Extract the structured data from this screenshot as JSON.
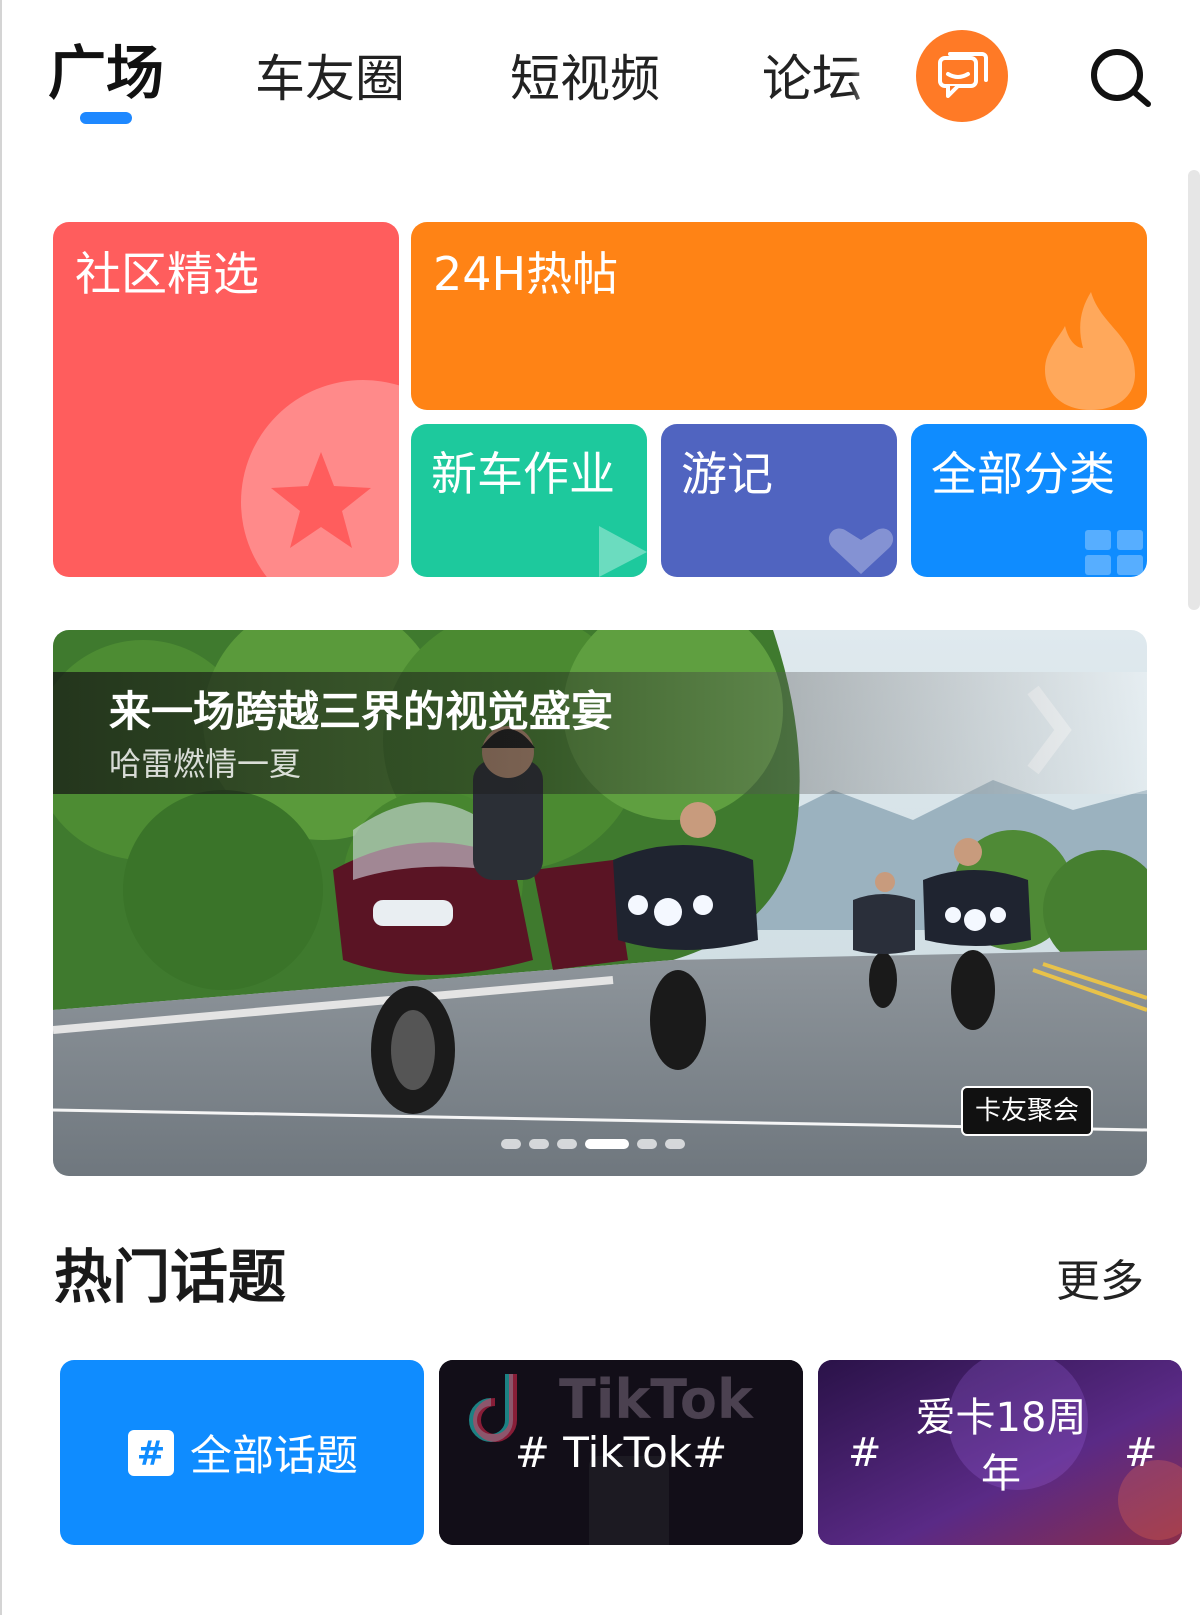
{
  "nav": {
    "tabs": [
      {
        "label": "广场",
        "active": true
      },
      {
        "label": "车友圈"
      },
      {
        "label": "短视频"
      },
      {
        "label": "论坛"
      }
    ],
    "message_icon": "chat-bubble-icon",
    "search_icon": "search-icon",
    "accent_color": "#1e88ff"
  },
  "categories": {
    "featured": {
      "label": "社区精选",
      "color": "#ff5d5d",
      "icon": "star-icon"
    },
    "hot": {
      "label": "24H热帖",
      "color": "#ff8315",
      "icon": "flame-icon"
    },
    "new_car": {
      "label": "新车作业",
      "color": "#1dc99d",
      "icon": "play-icon"
    },
    "travel": {
      "label": "游记",
      "color": "#5064c0",
      "icon": "heart-icon"
    },
    "all": {
      "label": "全部分类",
      "color": "#0f8cff",
      "icon": "grid-icon"
    }
  },
  "banner": {
    "title": "来一场跨越三界的视觉盛宴",
    "subtitle": "哈雷燃情一夏",
    "tag": "卡友聚会",
    "slides_total": 6,
    "active_slide": 4
  },
  "hot_topics": {
    "title": "热门话题",
    "more": "更多",
    "cards": [
      {
        "label": "全部话题",
        "icon": "hashtag-icon",
        "color": "#0f8cff"
      },
      {
        "label": "# TikTok#",
        "bg_text": "TikTok"
      },
      {
        "label_prefix": "#",
        "label": "爱卡18周年",
        "label_suffix": "#"
      }
    ]
  }
}
